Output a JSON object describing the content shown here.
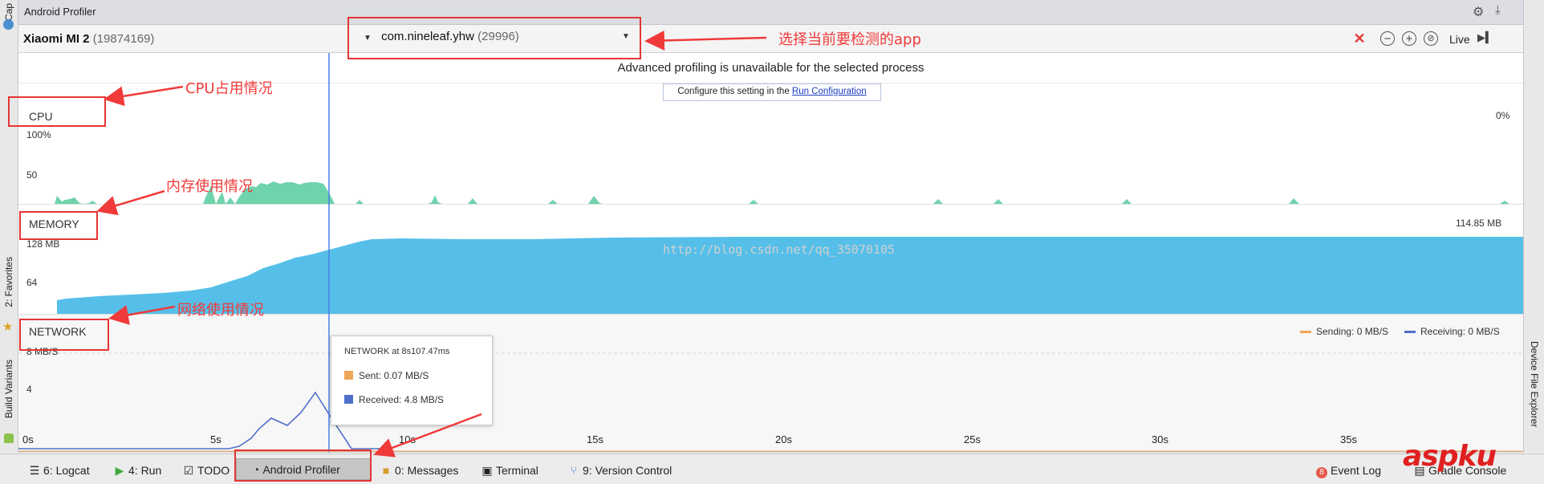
{
  "window": {
    "title": "Android Profiler"
  },
  "left_strip": {
    "captures": "Cap",
    "favorites": "2: Favorites",
    "build_variants": "Build Variants"
  },
  "right_strip": {
    "device_file_explorer": "Device File Explorer"
  },
  "device": {
    "name": "Xiaomi MI 2",
    "serial": "(19874169)"
  },
  "process": {
    "name": "com.nineleaf.yhw",
    "pid": "(29996)"
  },
  "toolbar": {
    "live_label": "Live"
  },
  "notice": {
    "message": "Advanced profiling is unavailable for the selected process",
    "config_prefix": "Configure this setting in the ",
    "config_link": "Run Configuration"
  },
  "cpu": {
    "label": "CPU",
    "tick_top": "100%",
    "tick_mid": "50",
    "current": "0%"
  },
  "memory": {
    "label": "MEMORY",
    "tick_top": "128 MB",
    "tick_mid": "64",
    "current": "114.85 MB"
  },
  "network": {
    "label": "NETWORK",
    "tick_top": "8 MB/S",
    "tick_mid": "4",
    "legend_sending": "Sending: 0 MB/S",
    "legend_receiving": "Receiving: 0 MB/S"
  },
  "tooltip": {
    "header": "NETWORK at 8s107.47ms",
    "sent": "Sent: 0.07 MB/S",
    "received": "Received:  4.8 MB/S"
  },
  "timeline": {
    "ticks": [
      "0s",
      "5s",
      "10s",
      "15s",
      "20s",
      "25s",
      "30s",
      "35s"
    ]
  },
  "watermark": "http://blog.csdn.net/qq_35070105",
  "annotations": {
    "select_app": "选择当前要检测的app",
    "cpu_usage": "CPU占用情况",
    "memory_usage": "内存使用情况",
    "network_usage": "网络使用情况"
  },
  "bottom_bar": {
    "logcat": "6: Logcat",
    "run": "4: Run",
    "todo": "TODO",
    "profiler": "Android Profiler",
    "messages": "0: Messages",
    "terminal": "Terminal",
    "version_control": "9: Version Control",
    "event_log": "Event Log",
    "event_badge": "8",
    "gradle_console": "Gradle Console"
  },
  "logo": "aspku",
  "colors": {
    "cpu_fill": "#6fd3ac",
    "memory_fill": "#56bfe9",
    "network_line": "#4f70c9",
    "sending": "#f0a65a",
    "receiving": "#4f70c9",
    "annotation": "#f03a3a",
    "cursor": "#4a7ee8"
  }
}
